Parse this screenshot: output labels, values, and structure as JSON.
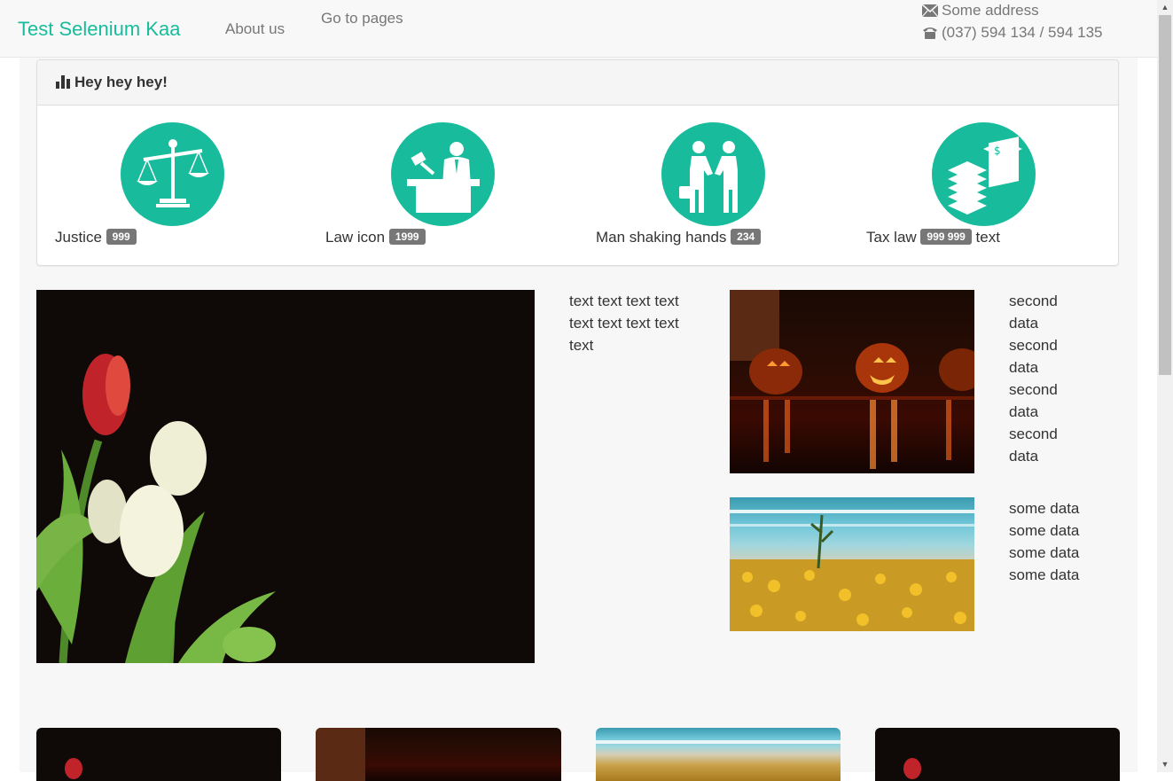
{
  "navbar": {
    "brand": "Test Selenium Kaa",
    "links": [
      "About us",
      "Go to pages"
    ],
    "address": "Some address",
    "phone": "(037) 594 134 / 594 135"
  },
  "panel": {
    "title": "Hey hey hey!",
    "icon": "bar-chart-icon",
    "features": [
      {
        "label": "Justice",
        "badge": "999",
        "suffix": "",
        "icon": "scales-icon"
      },
      {
        "label": "Law icon",
        "badge": "1999",
        "suffix": "",
        "icon": "judge-icon"
      },
      {
        "label": "Man shaking hands",
        "badge": "234",
        "suffix": "",
        "icon": "handshake-icon"
      },
      {
        "label": "Tax law",
        "badge": "999 999",
        "suffix": "text",
        "icon": "money-stack-icon"
      }
    ]
  },
  "content": {
    "text_block": "text text text text text text text text text",
    "second_data": "second data second data second data second data",
    "some_data": "some data some data some data some data"
  },
  "colors": {
    "accent": "#18bc9c",
    "badge": "#777777",
    "nav_bg": "#f8f8f8"
  }
}
